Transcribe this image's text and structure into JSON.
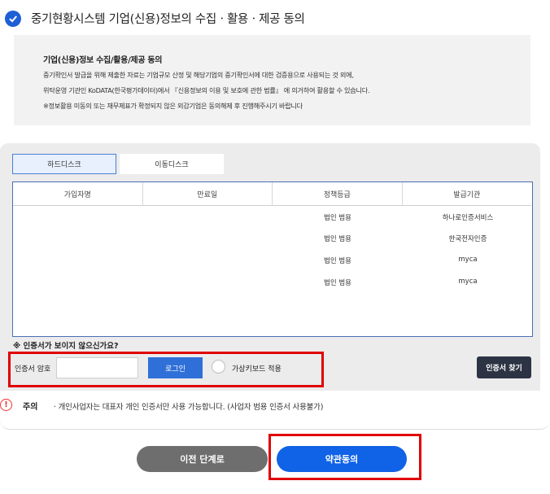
{
  "header": {
    "title": "중기현황시스템 기업(신용)정보의 수집ㆍ활용ㆍ제공 동의",
    "check_icon": "check-circle-icon"
  },
  "notice": {
    "title": "기업(신용)정보 수집/활용/제공 동의",
    "lines": [
      "중기확인서 발급을 위해 제출한 자료는 기업규모 산정 및 해당기업의 중기확인서에 대한 검증용으로 사용되는 것 외에,",
      "위탁운영 기관인 KoDATA(한국평가데이터)에서 『신용정보의 이용 및 보호에 관한 법률』 에 의거하여 활용할 수 있습니다.",
      "※정보활용 미동의 또는 재무제표가 확정되지 않은 외감기업은 동의해제 후 진행해주시기 바랍니다"
    ]
  },
  "tabs": [
    {
      "label": "하드디스크",
      "active": true
    },
    {
      "label": "이동디스크",
      "active": false
    }
  ],
  "cert_table": {
    "columns": [
      "가입자명",
      "만료일",
      "정책등급",
      "발급기관"
    ],
    "rows": [
      {
        "name": "",
        "expiry": "",
        "type": "법인 범용",
        "issuer": "하나로인증서비스"
      },
      {
        "name": "",
        "expiry": "",
        "type": "법인 범용",
        "issuer": "한국전자인증"
      },
      {
        "name": "",
        "expiry": "",
        "type": "법인 범용",
        "issuer": "myca"
      },
      {
        "name": "",
        "expiry": "",
        "type": "법인 범용",
        "issuer": "myca"
      }
    ]
  },
  "not_found_text": "※ 인증서가 보이지 않으신가요?",
  "login": {
    "password_label": "인증서 암호",
    "password_value": "",
    "login_button": "로그인",
    "virtual_keyboard_label": "가상키보드 적용",
    "virtual_keyboard_checked": false,
    "find_cert_button": "인증서 찾기"
  },
  "warning": {
    "icon": "exclamation-circle-icon",
    "label": "주의",
    "text": "· 개인사업자는 대표자 개인 인증서만 사용 가능합니다. (사업자 범용 인증서 사용불가)"
  },
  "footer": {
    "prev_button": "이전 단계로",
    "agree_button": "약관동의"
  },
  "colors": {
    "primary_blue": "#1062e6",
    "login_blue": "#2f6fd8",
    "highlight_red": "#e00000",
    "dark_button": "#2c3444",
    "gray_button": "#6e6e6e"
  }
}
